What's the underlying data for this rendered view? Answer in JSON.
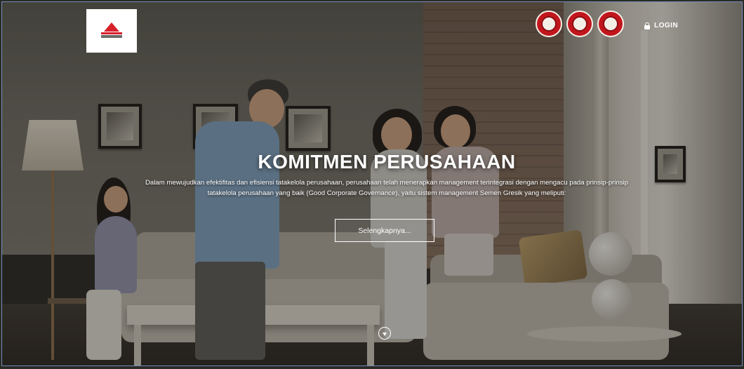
{
  "header": {
    "logo_icon": "semen-indonesia-logo",
    "badges": [
      {
        "icon": "certification-seal-icon"
      },
      {
        "icon": "certification-seal-icon"
      },
      {
        "icon": "certification-seal-icon"
      }
    ],
    "login_label": "LOGIN",
    "login_icon": "lock-icon"
  },
  "hero": {
    "title": "KOMITMEN PERUSAHAAN",
    "description": "Dalam mewujudkan efektifitas dan efisiensi tatakelola perusahaan, perusahaan telah menerapkan management terintegrasi dengan mengacu pada prinsip-prinsip tatakelola perusahaan yang baik (Good Corporate Governance), yaitu sistem management Semen Gresik yang meliputi:",
    "cta_label": "Selengkapnya...",
    "scroll_icon": "scroll-down-icon"
  },
  "colors": {
    "accent_red": "#c2161d",
    "text": "#ffffff"
  }
}
